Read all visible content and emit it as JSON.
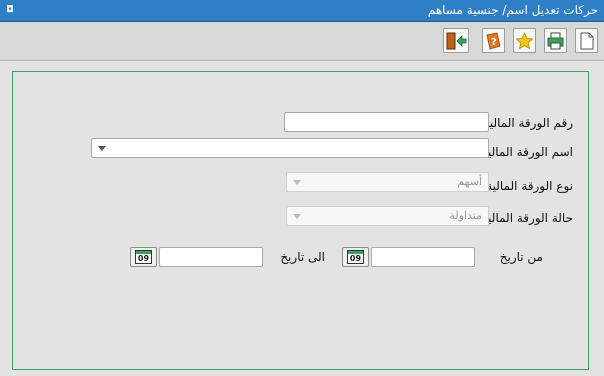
{
  "window": {
    "title": "حركات تعديل اسم/ جنسية مساهم",
    "icon": "app-icon",
    "icon_glyph": "◘"
  },
  "toolbar": {
    "buttons": [
      {
        "name": "new-document",
        "icon": "document-icon"
      },
      {
        "name": "print",
        "icon": "printer-icon"
      },
      {
        "name": "favorite",
        "icon": "star-icon"
      },
      {
        "name": "help",
        "icon": "help-icon"
      },
      {
        "name": "exit",
        "icon": "exit-door-icon"
      }
    ]
  },
  "form": {
    "security_number_label": "رقم الورقة المالية",
    "security_number_value": "",
    "security_name_label": "اسم الورقة المالية",
    "security_name_value": "",
    "security_type_label": "نوع الورقة المالية",
    "security_type_value": "أسهم",
    "security_status_label": "حالة الورقة المالية",
    "security_status_value": "متداولة",
    "from_date_label": "من تاريخ",
    "from_date_value": "",
    "to_date_label": "الى تاريخ",
    "to_date_value": "",
    "calendar_icon_text": "09"
  },
  "colors": {
    "titlebar": "#2f7fc6",
    "panel_border": "#3aa35e",
    "background": "#e3e3e3"
  }
}
